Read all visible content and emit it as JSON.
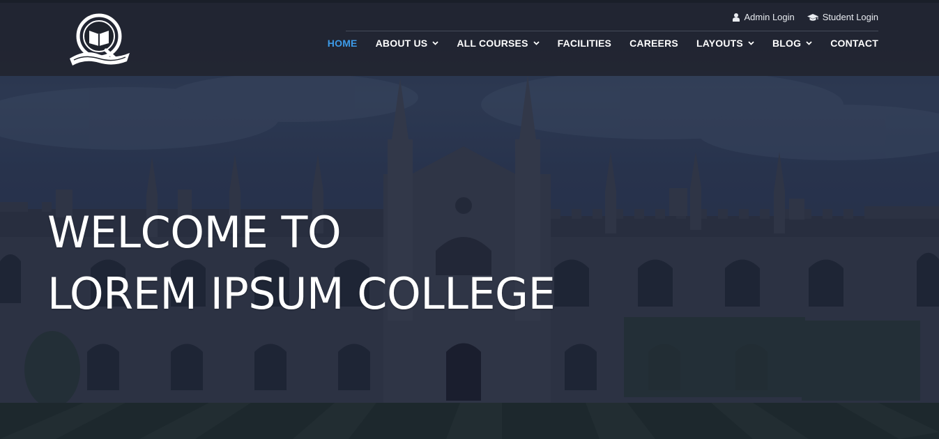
{
  "header": {
    "logo_icon": "open-book-crest-logo",
    "logins": [
      {
        "label": "Admin Login",
        "icon": "user-icon"
      },
      {
        "label": "Student Login",
        "icon": "graduation-cap-icon"
      }
    ],
    "nav": [
      {
        "label": "HOME",
        "active": true,
        "dropdown": false
      },
      {
        "label": "ABOUT US",
        "active": false,
        "dropdown": true
      },
      {
        "label": "ALL COURSES",
        "active": false,
        "dropdown": true
      },
      {
        "label": "FACILITIES",
        "active": false,
        "dropdown": false
      },
      {
        "label": "CAREERS",
        "active": false,
        "dropdown": false
      },
      {
        "label": "LAYOUTS",
        "active": false,
        "dropdown": true
      },
      {
        "label": "BLOG",
        "active": false,
        "dropdown": true
      },
      {
        "label": "CONTACT",
        "active": false,
        "dropdown": false
      }
    ],
    "active_color": "#3d9be9"
  },
  "hero": {
    "title_line1": "WELCOME TO",
    "title_line2": "LOREM IPSUM COLLEGE",
    "background": "gothic-college-building-photo"
  }
}
